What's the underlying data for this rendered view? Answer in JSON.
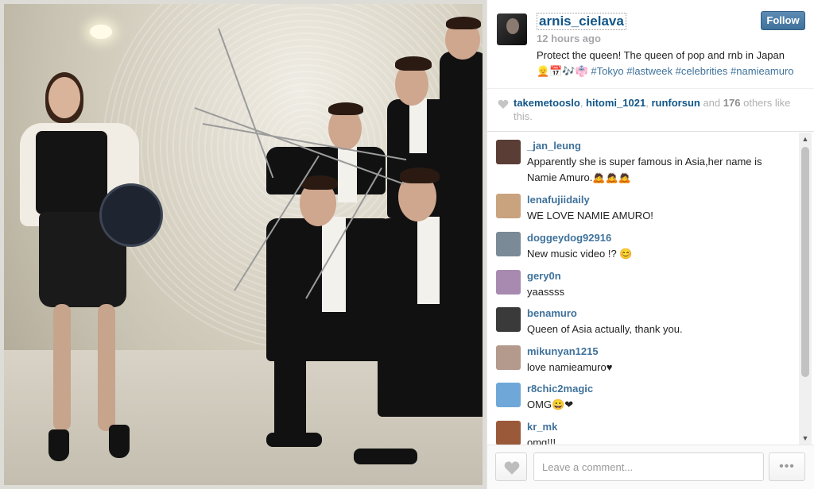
{
  "post": {
    "image_alt": "",
    "username": "arnis_cielava",
    "time": "12 hours ago",
    "follow_label": "Follow",
    "caption": {
      "text_prefix": "Protect the queen! The queen of pop and rnb in Japan",
      "emoji": "👱📅🎶👘",
      "hashtags": [
        "#Tokyo",
        "#lastweek",
        "#celebrities",
        "#namieamuro"
      ]
    }
  },
  "likes": {
    "likers": [
      "takemetooslo",
      "hitomi_1021",
      "runforsun"
    ],
    "and_text": "and",
    "count": "176",
    "suffix": "others like this."
  },
  "comments": [
    {
      "user": "_jan_leung",
      "text": "Apparently she is super famous in Asia,her name is Namie Amuro.🙇🙇🙇",
      "avatar_color": "#5a3e36"
    },
    {
      "user": "lenafujiidaily",
      "text": "WE LOVE NAMIE AMURO!",
      "avatar_color": "#c9a27e"
    },
    {
      "user": "doggeydog92916",
      "text": "New music video !? 😊",
      "avatar_color": "#7a8a96"
    },
    {
      "user": "gery0n",
      "text": "yaassss",
      "avatar_color": "#a88ab0"
    },
    {
      "user": "benamuro",
      "text": "Queen of Asia actually, thank you.",
      "avatar_color": "#3a3a3a"
    },
    {
      "user": "mikunyan1215",
      "text": "love namieamuro♥",
      "avatar_color": "#b39a8c"
    },
    {
      "user": "r8chic2magic",
      "text": "OMG😀❤",
      "avatar_color": "#6fa8d8"
    },
    {
      "user": "kr_mk",
      "text": "omg!!!",
      "avatar_color": "#9a5a3a"
    }
  ],
  "footer": {
    "comment_placeholder": "Leave a comment...",
    "more_label": "•••"
  },
  "colors": {
    "link": "#3f729b",
    "username": "#125688",
    "follow_bg": "#3f729b"
  },
  "icons": {
    "like": "heart-icon",
    "more": "ellipsis-icon",
    "scroll_up": "arrow-up-icon",
    "scroll_down": "arrow-down-icon"
  }
}
